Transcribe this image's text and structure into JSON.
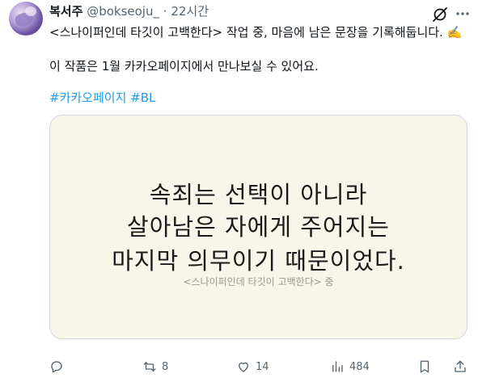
{
  "author": {
    "name": "복서주",
    "handle": "@bokseoju_",
    "separator": "·",
    "time": "22시간"
  },
  "body": {
    "line1": "<스나이퍼인데 타깃이 고백한다> 작업 중, 마음에 남은 문장을 기록해둡니다. ✍️",
    "line2": "이 작품은 1월 카카오페이지에서 만나보실 수 있어요.",
    "hashtags": [
      "#카카오페이지",
      "#BL"
    ]
  },
  "card": {
    "quote_lines": [
      "속죄는 선택이 아니라",
      "살아남은 자에게 주어지는",
      "마지막 의무이기 때문이었다."
    ],
    "source": "<스나이퍼인데 타깃이 고백한다> 중",
    "background": "#f8f5e9"
  },
  "actions": {
    "replies": "",
    "retweets": "8",
    "likes": "14",
    "views": "484"
  },
  "icons": {
    "reply": "reply-icon",
    "retweet": "retweet-icon",
    "like": "heart-icon",
    "views": "views-icon",
    "bookmark": "bookmark-icon",
    "share": "share-icon",
    "grok": "grok-icon",
    "more": "more-icon"
  },
  "colors": {
    "link": "#1d9bf0",
    "muted": "#536471",
    "text": "#0f1419"
  }
}
